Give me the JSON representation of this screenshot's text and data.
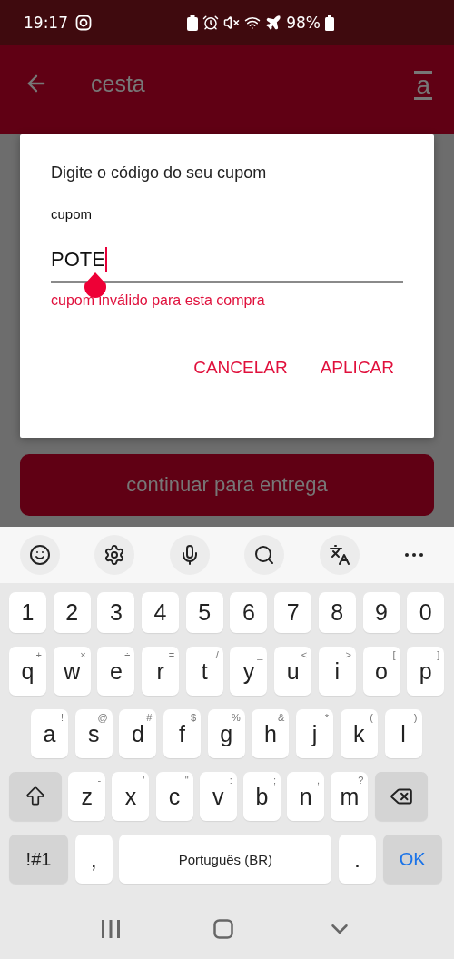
{
  "status_bar": {
    "time": "19:17",
    "battery": "98%"
  },
  "app_bar": {
    "title": "cesta",
    "logo": "a"
  },
  "dialog": {
    "title": "Digite o código do seu cupom",
    "field_label": "cupom",
    "value": "POTE",
    "error": "cupom inválido para esta compra",
    "buttons": [
      "CANCELAR",
      "APLICAR"
    ]
  },
  "continue_button": {
    "label": "continuar para entrega"
  },
  "keyboard": {
    "number_row": [
      "1",
      "2",
      "3",
      "4",
      "5",
      "6",
      "7",
      "8",
      "9",
      "0"
    ],
    "letter_rows": [
      [
        {
          "label": "q",
          "hint": "+"
        },
        {
          "label": "w",
          "hint": "×"
        },
        {
          "label": "e",
          "hint": "÷"
        },
        {
          "label": "r",
          "hint": "="
        },
        {
          "label": "t",
          "hint": "/"
        },
        {
          "label": "y",
          "hint": "_"
        },
        {
          "label": "u",
          "hint": "<"
        },
        {
          "label": "i",
          "hint": ">"
        },
        {
          "label": "o",
          "hint": "["
        },
        {
          "label": "p",
          "hint": "]"
        }
      ],
      [
        {
          "label": "a",
          "hint": "!"
        },
        {
          "label": "s",
          "hint": "@"
        },
        {
          "label": "d",
          "hint": "#"
        },
        {
          "label": "f",
          "hint": "$"
        },
        {
          "label": "g",
          "hint": "%"
        },
        {
          "label": "h",
          "hint": "&"
        },
        {
          "label": "j",
          "hint": "*"
        },
        {
          "label": "k",
          "hint": "("
        },
        {
          "label": "l",
          "hint": ")"
        }
      ],
      [
        {
          "kind": "shift"
        },
        {
          "kind": "char",
          "label": "z",
          "hint": "-"
        },
        {
          "kind": "char",
          "label": "x",
          "hint": "'"
        },
        {
          "kind": "char",
          "label": "c",
          "hint": "\""
        },
        {
          "kind": "char",
          "label": "v",
          "hint": ":"
        },
        {
          "kind": "char",
          "label": "b",
          "hint": ";"
        },
        {
          "kind": "char",
          "label": "n",
          "hint": ","
        },
        {
          "kind": "char",
          "label": "m",
          "hint": "?"
        },
        {
          "kind": "backspace"
        }
      ]
    ],
    "bottom_row": [
      {
        "kind": "symbols",
        "label": "!#1"
      },
      {
        "kind": "char",
        "label": ","
      },
      {
        "kind": "space",
        "label": "Português (BR)"
      },
      {
        "kind": "char",
        "label": "."
      },
      {
        "kind": "action",
        "label": "OK"
      }
    ]
  }
}
